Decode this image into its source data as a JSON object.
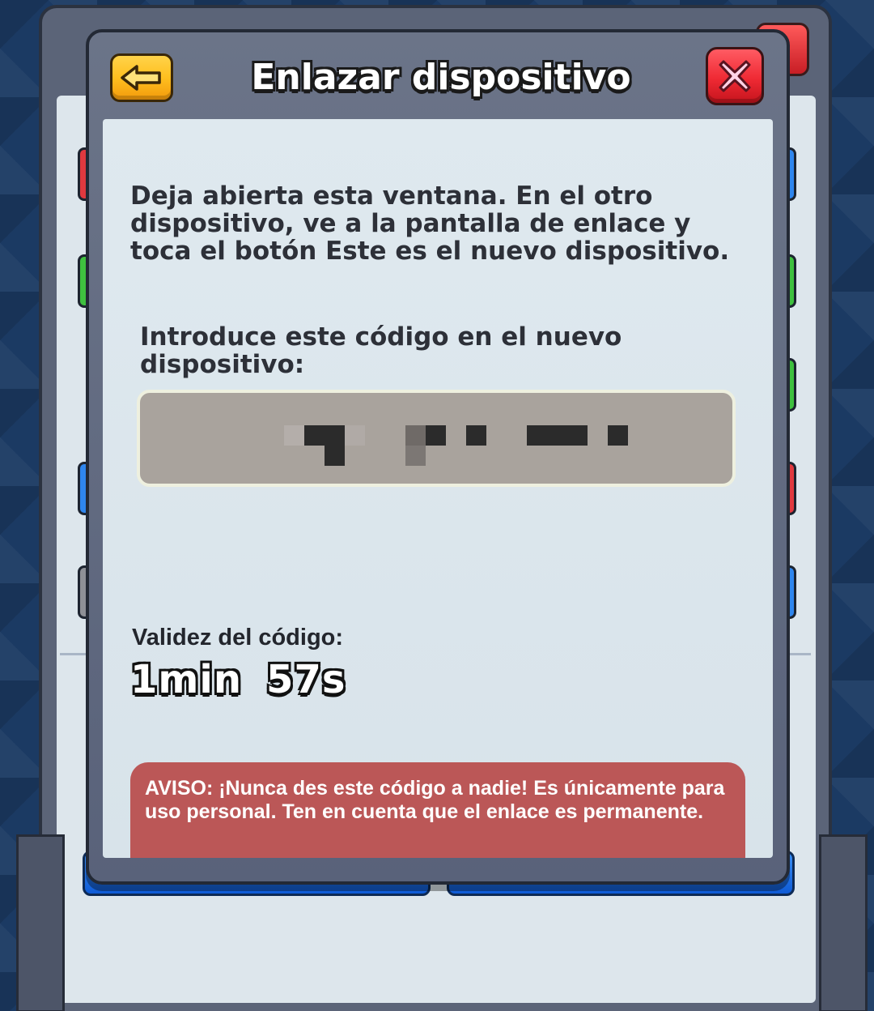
{
  "dialog": {
    "title": "Enlazar dispositivo",
    "back_icon": "arrow-left-icon",
    "close_icon": "close-x-icon"
  },
  "body": {
    "instructions": "Deja abierta esta ventana. En el otro dispositivo, ve a la pantalla de enlace y toca el botón Este es el nuevo dispositivo.",
    "code_label": "Introduce este código en el nuevo dispositivo:",
    "code_value": "",
    "validity_label": "Validez del código:",
    "timer": {
      "minutes": "1min",
      "seconds": "57s"
    },
    "warning": "AVISO: ¡Nunca des este código a nadie! Es únicamente para uso personal. Ten en cuenta que el enlace es permanente."
  },
  "colors": {
    "back_button": "#ffbf1f",
    "close_button": "#ef2a34",
    "warning_bg": "#bb5757",
    "code_box_bg": "#a9a39d"
  }
}
